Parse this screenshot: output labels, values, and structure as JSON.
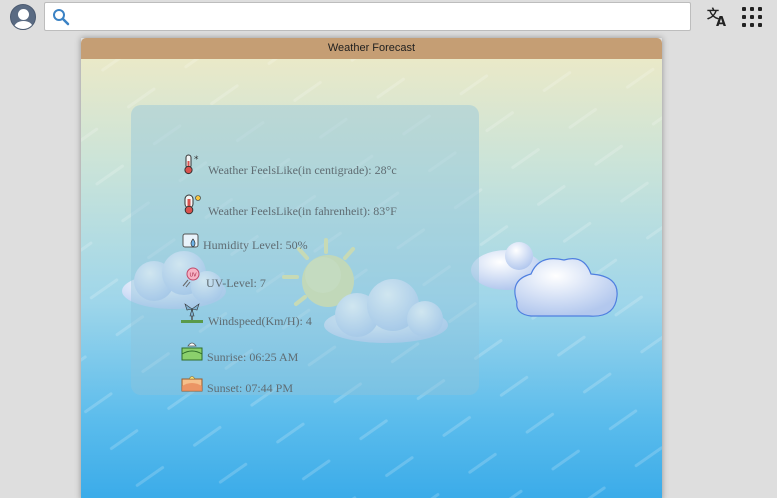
{
  "browser": {
    "search": {
      "value": "",
      "placeholder": ""
    },
    "icons": {
      "profile": "avatar-icon",
      "search": "search-icon",
      "translate": "translate-icon",
      "apps": "apps-grid-icon"
    }
  },
  "window": {
    "title": "Weather Forecast",
    "colors": {
      "titlebar": "#c59e74",
      "gradient_top": "#eae9c8",
      "gradient_bottom": "#3aabe9",
      "panel": "#8fc4dc",
      "text": "#5f6c72"
    }
  },
  "weather": {
    "items": [
      {
        "icon": "thermometer-snow-icon",
        "label": "Weather FeelsLike(in centigrade): 28°c"
      },
      {
        "icon": "thermometer-sun-icon",
        "label": "Weather FeelsLike(in fahrenheit): 83°F"
      },
      {
        "icon": "humidity-icon",
        "label": "Humidity Level: 50%"
      },
      {
        "icon": "uv-icon",
        "label": "UV-Level: 7"
      },
      {
        "icon": "windmill-icon",
        "label": "Windspeed(Km/H): 4"
      },
      {
        "icon": "sunrise-icon",
        "label": "Sunrise: 06:25 AM"
      },
      {
        "icon": "sunset-icon",
        "label": "Sunset: 07:44 PM"
      }
    ]
  },
  "illustration": {
    "sun": "sun-icon",
    "clouds": [
      "cloud-icon",
      "cloud-icon",
      "cloud-icon"
    ]
  }
}
